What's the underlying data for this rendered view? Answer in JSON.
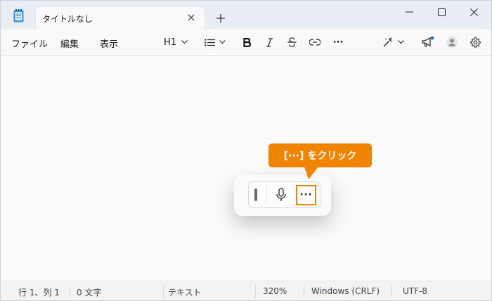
{
  "window": {
    "tab_title": "タイトルなし",
    "new_tab_symbol": "+"
  },
  "menu": {
    "file": "ファイル",
    "edit": "編集",
    "view": "表示"
  },
  "toolbar": {
    "heading": "H1",
    "more": "···"
  },
  "dictation": {
    "more": "···"
  },
  "callout": {
    "text": "[···] をクリック",
    "color": "#f08300"
  },
  "status": {
    "position": "行 1、列 1",
    "chars": "0 文字",
    "format": "テキスト",
    "zoom": "320%",
    "line_ending": "Windows (CRLF)",
    "encoding": "UTF-8"
  },
  "icons": [
    "notepad-app-icon",
    "close-icon",
    "plus-icon",
    "minimize-icon",
    "maximize-icon",
    "window-close-icon",
    "chevron-down-icon",
    "bulleted-list-icon",
    "bold-icon",
    "italic-icon",
    "strikethrough-icon",
    "link-icon",
    "copilot-icon",
    "megaphone-icon",
    "avatar-icon",
    "gear-icon",
    "grip-icon",
    "microphone-icon"
  ]
}
